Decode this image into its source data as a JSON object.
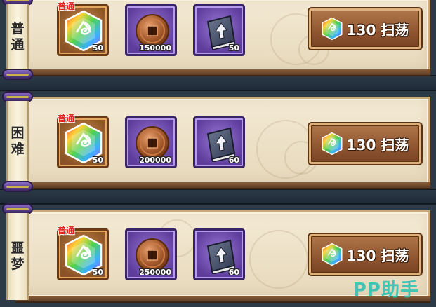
{
  "difficulties": [
    {
      "name_chars": [
        "普",
        "通"
      ],
      "rewards": [
        {
          "type": "gem",
          "icon": "hexagon-gem-icon",
          "tag": "普通",
          "count": "50"
        },
        {
          "type": "coin",
          "icon": "copper-coin-icon",
          "count": "150000"
        },
        {
          "type": "book",
          "icon": "upgrade-book-icon",
          "count": "50"
        }
      ],
      "sweep": {
        "label": "130 扫荡",
        "icon": "hexagon-gem-icon"
      }
    },
    {
      "name_chars": [
        "困",
        "难"
      ],
      "rewards": [
        {
          "type": "gem",
          "icon": "hexagon-gem-icon",
          "tag": "普通",
          "count": "50"
        },
        {
          "type": "coin",
          "icon": "copper-coin-icon",
          "count": "200000"
        },
        {
          "type": "book",
          "icon": "upgrade-book-icon",
          "count": "60"
        }
      ],
      "sweep": {
        "label": "130 扫荡",
        "icon": "hexagon-gem-icon"
      }
    },
    {
      "name_chars": [
        "噩",
        "梦"
      ],
      "rewards": [
        {
          "type": "gem",
          "icon": "hexagon-gem-icon",
          "tag": "普通",
          "count": "50"
        },
        {
          "type": "coin",
          "icon": "copper-coin-icon",
          "count": "250000"
        },
        {
          "type": "book",
          "icon": "upgrade-book-icon",
          "count": "60"
        }
      ],
      "sweep": {
        "label": "130 扫荡",
        "icon": "hexagon-gem-icon"
      }
    }
  ],
  "watermark": "PP助手",
  "colors": {
    "panel": "#ece0c6",
    "band": "#2b3947",
    "slot_orange": "#8c5426",
    "slot_purple": "#5d3c9c",
    "button": "#8e5530",
    "tag_red": "#e8231d",
    "watermark": "#2fc4b4"
  }
}
